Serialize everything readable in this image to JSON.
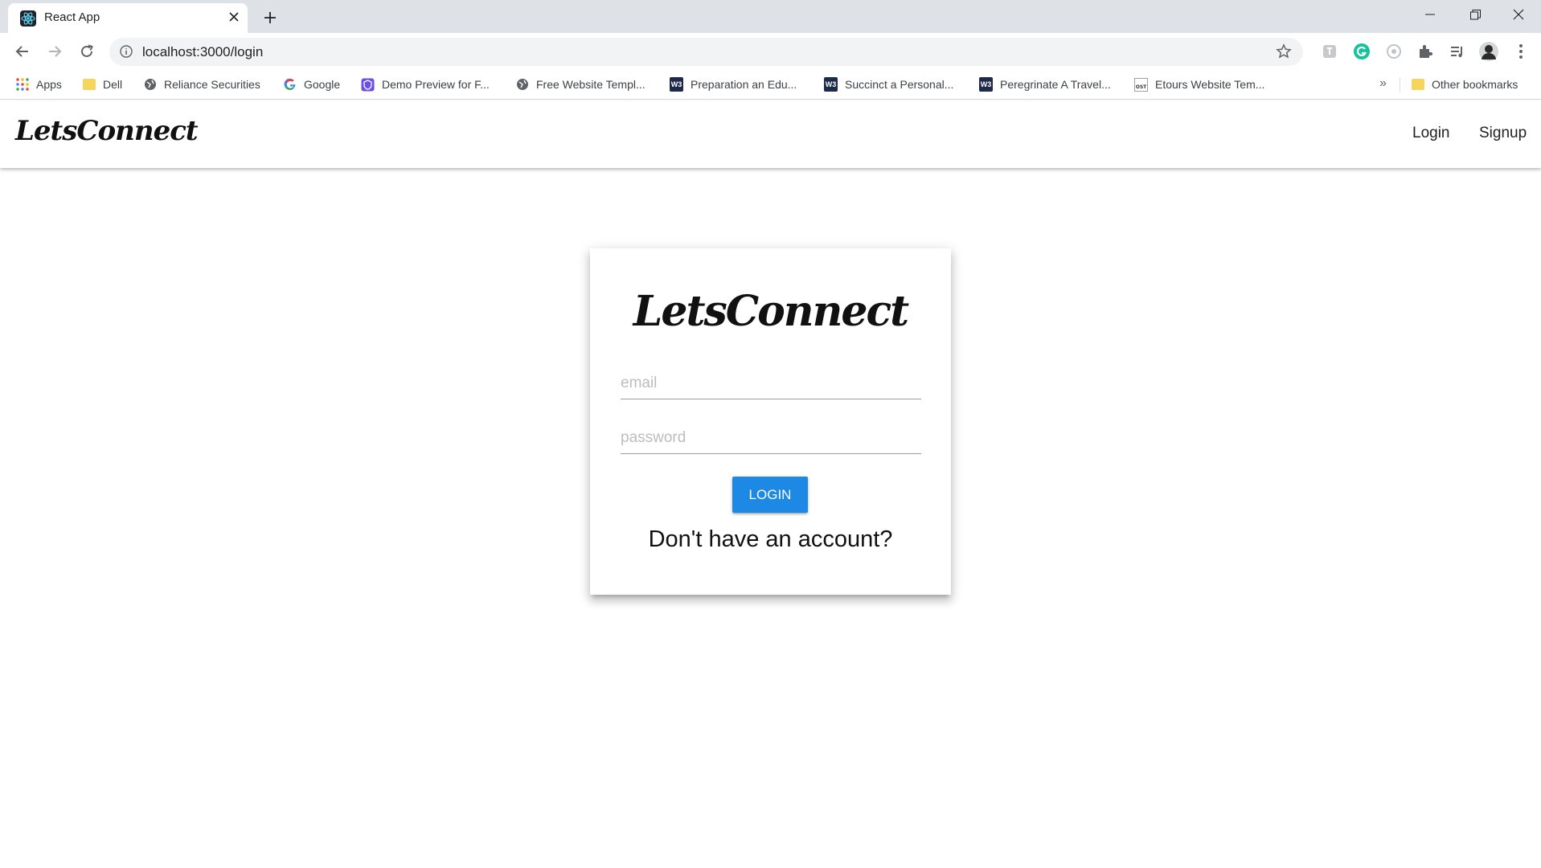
{
  "browser": {
    "tab_title": "React App",
    "url": "localhost:3000/login",
    "bookmarks": [
      {
        "label": "Apps",
        "icon": "apps-grid-icon"
      },
      {
        "label": "Dell",
        "icon": "folder-icon"
      },
      {
        "label": "Reliance Securities",
        "icon": "globe-icon"
      },
      {
        "label": "Google",
        "icon": "google-icon"
      },
      {
        "label": "Demo Preview for F...",
        "icon": "shield-icon"
      },
      {
        "label": "Free Website Templ...",
        "icon": "globe-icon"
      },
      {
        "label": "Preparation an Edu...",
        "icon": "w3layouts-icon"
      },
      {
        "label": "Succinct a Personal...",
        "icon": "w3layouts-icon"
      },
      {
        "label": "Peregrinate A Travel...",
        "icon": "w3layouts-icon"
      },
      {
        "label": "Etours Website Tem...",
        "icon": "ost-icon"
      }
    ],
    "more_bookmarks": "»",
    "other_bookmarks": "Other bookmarks"
  },
  "app": {
    "brand": "LetsConnect",
    "nav": {
      "login": "Login",
      "signup": "Signup"
    },
    "card": {
      "brand": "LetsConnect",
      "email_placeholder": "email",
      "password_placeholder": "password",
      "login_button": "LOGIN",
      "signup_prompt": "Don't have an account?"
    }
  },
  "colors": {
    "accent": "#1e88e5",
    "tabbar": "#dee1e6"
  }
}
